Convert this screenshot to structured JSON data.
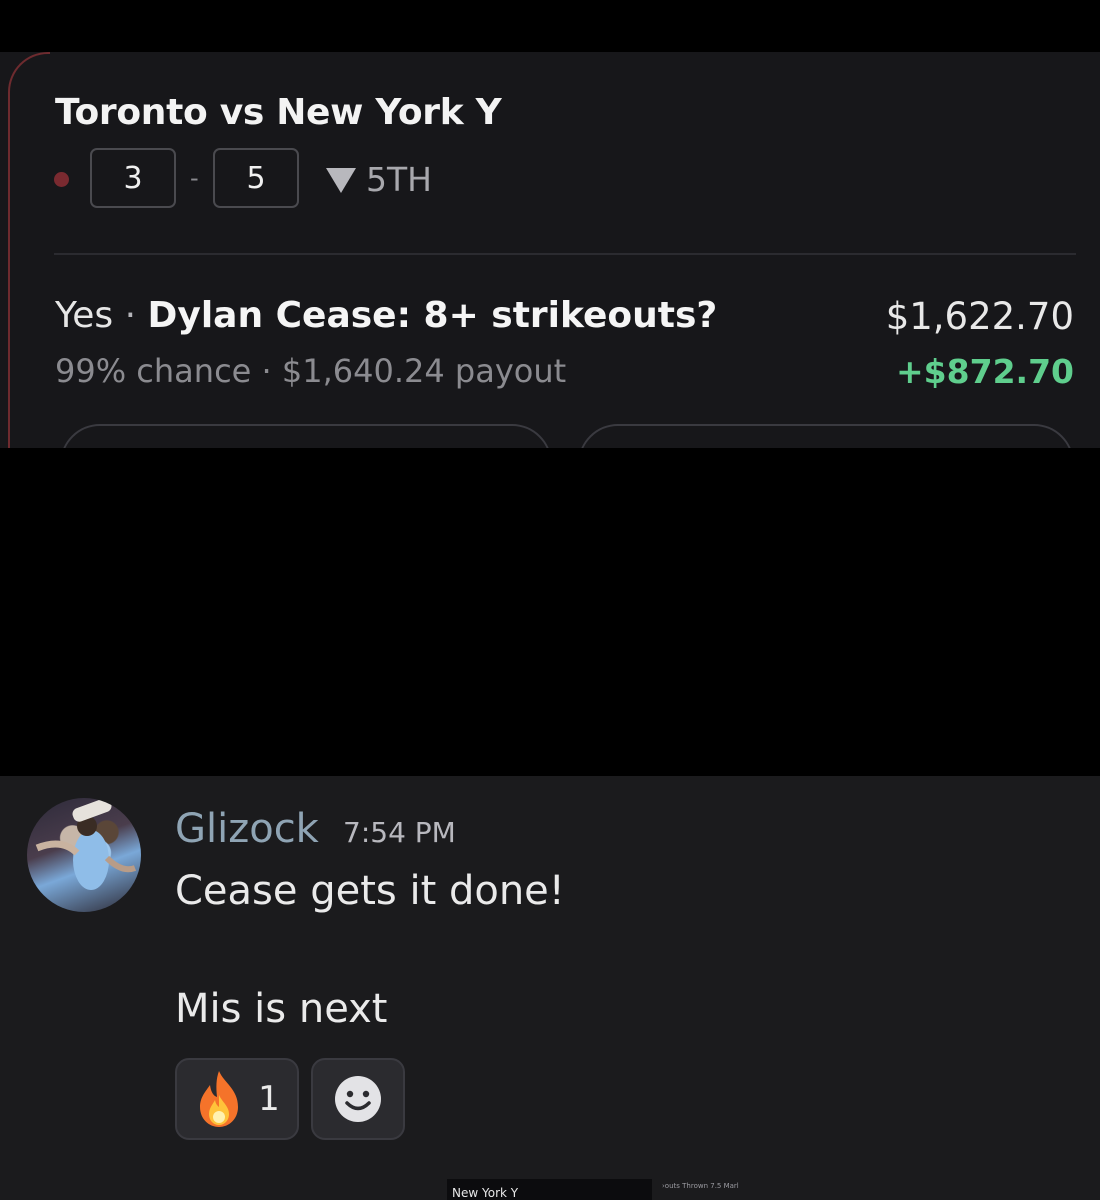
{
  "bet_card": {
    "match_title": "Toronto vs New York Y",
    "score_home": "3",
    "score_separator": "-",
    "score_away": "5",
    "inning": "5TH",
    "bet_side": "Yes",
    "bet_separator": "·",
    "bet_title": "Dylan Cease: 8+ strikeouts?",
    "bet_meta": "99% chance · $1,640.24 payout",
    "bet_amount": "$1,622.70",
    "bet_profit": "+$872.70",
    "colors": {
      "card_background": "#17171a",
      "profit": "#5fce8d",
      "live_dot": "#7a2a30"
    }
  },
  "chat": {
    "username": "Glizock",
    "timestamp": "7:54 PM",
    "messages": [
      "Cease gets it done!",
      "Mis is next"
    ],
    "reactions": [
      {
        "icon": "fire-emoji-icon",
        "count": "1"
      },
      {
        "icon": "add-reaction-smiley-icon"
      }
    ],
    "footer_labels": [
      "New York Y",
      "›outs Thrown 7.5 Marl"
    ],
    "colors": {
      "background": "#1b1b1d",
      "username": "#8fa4b4"
    }
  }
}
